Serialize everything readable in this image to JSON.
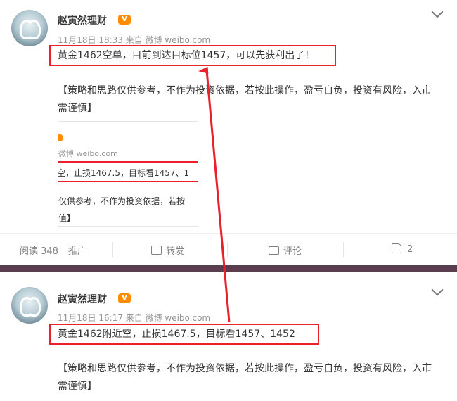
{
  "posts": [
    {
      "author": "赵寅然理财",
      "vip_badge": "V",
      "meta": "11月18日 18:33 来自 微博 weibo.com",
      "headline": "黄金1462空单，目前到达目标位1457，可以先获利出了！",
      "disclaimer": "【策略和思路仅供参考，不作为投资依据，若按此操作，盈亏自负，投资有风险，入市需谨慎】",
      "thumbnail": {
        "meta": "微博 weibo.com",
        "line1": "空，止损1467.5，目标看1457、1",
        "line2": "仅供参考，不作为投资依据，若按",
        "line3": "值】"
      },
      "actions": {
        "reads": "阅读 348",
        "promote": "推广",
        "repost": "转发",
        "comment": "评论",
        "likes": "2"
      }
    },
    {
      "author": "赵寅然理财",
      "vip_badge": "V",
      "meta": "11月18日 16:17 来自 微博 weibo.com",
      "headline": "黄金1462附近空，止损1467.5，目标看1457、1452",
      "disclaimer": "【策略和思路仅供参考，不作为投资依据，若按此操作，盈亏自负，投资有风险，入市需谨慎】"
    }
  ],
  "colors": {
    "highlight": "#e8212a",
    "divider": "#5a3e50",
    "meta_text": "#939393"
  },
  "icons": [
    "swan-avatar",
    "vip-badge-icon",
    "chevron-down-icon",
    "share-icon",
    "comment-icon",
    "like-icon"
  ]
}
